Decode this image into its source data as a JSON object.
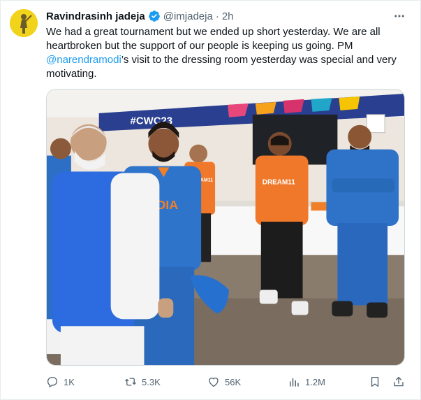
{
  "tweet": {
    "author_name": "Ravindrasinh jadeja",
    "handle": "@imjadeja",
    "separator": "·",
    "time": "2h",
    "text_before_mention": "We had a great tournament but we ended up short yesterday. We are all heartbroken but the support of our people is keeping us going. PM ",
    "mention": "@narendramodi",
    "text_after_mention": "’s visit to the dressing room yesterday was special and very motivating."
  },
  "media": {
    "banner_text": "#CWC23",
    "jersey_text": "INDIA",
    "sponsor_text": "DREAM11"
  },
  "actions": {
    "replies": "1K",
    "retweets": "5.3K",
    "likes": "56K",
    "views": "1.2M"
  },
  "icons": {
    "verified": "verified-badge-icon",
    "more": "more-icon",
    "reply": "reply-icon",
    "retweet": "retweet-icon",
    "like": "heart-icon",
    "views": "views-icon",
    "bookmark": "bookmark-icon",
    "share": "share-icon"
  },
  "colors": {
    "accent": "#1d9bf0",
    "text": "#0f1419",
    "muted": "#536471",
    "avatar_bg": "#f2d31b"
  }
}
